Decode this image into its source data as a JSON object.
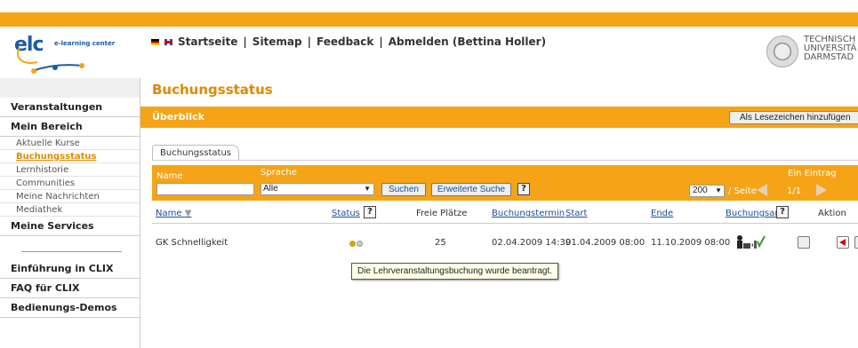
{
  "header": {
    "logo_text": "elc",
    "logo_subtitle": "e-learning center",
    "nav": [
      {
        "label": "Startseite"
      },
      {
        "label": "Sitemap"
      },
      {
        "label": "Feedback"
      },
      {
        "label": "Abmelden (Bettina Holler)"
      }
    ],
    "separator": "|",
    "university_lines": [
      "TECHNISCH",
      "UNIVERSITÄ",
      "DARMSTAD"
    ]
  },
  "sidebar": {
    "sections": [
      {
        "label": "Veranstaltungen"
      },
      {
        "label": "Mein Bereich"
      }
    ],
    "items": [
      {
        "label": "Aktuelle Kurse"
      },
      {
        "label": "Buchungsstatus"
      },
      {
        "label": "Lernhistorie"
      },
      {
        "label": "Communities"
      },
      {
        "label": "Meine Nachrichten"
      },
      {
        "label": "Mediathek"
      }
    ],
    "services": "Meine Services",
    "bottom": [
      {
        "label": "Einführung in CLIX"
      },
      {
        "label": "FAQ für CLIX"
      },
      {
        "label": "Bedienungs-Demos"
      }
    ]
  },
  "main": {
    "page_title": "Buchungsstatus",
    "overview_label": "Überblick",
    "bookmark_button": "Als Lesezeichen hinzufügen",
    "tab_label": "Buchungsstatus",
    "search": {
      "name_label": "Name",
      "name_value": "",
      "language_label": "Sprache",
      "language_value": "Alle",
      "search_button": "Suchen",
      "advanced_button": "Erweiterte Suche",
      "help": "?",
      "entries_label": "Ein Eintrag",
      "per_page_value": "200",
      "per_page_label": "/ Seite",
      "page_indicator": "1/1"
    },
    "table": {
      "columns": {
        "name": "Name",
        "status": "Status",
        "free": "Freie Plätze",
        "booking_date": "Buchungstermin",
        "start": "Start",
        "end": "Ende",
        "booking_type": "Buchungsart",
        "action": "Aktion"
      },
      "rows": [
        {
          "name": "GK Schnelligkeit",
          "free": "25",
          "booking_date": "02.04.2009 14:39",
          "start": "01.04.2009 08:00",
          "end": "11.10.2009 08:00"
        }
      ]
    },
    "tooltip": "Die Lehrveranstaltungsbuchung wurde beantragt."
  },
  "colors": {
    "accent": "#f5a417",
    "title": "#e08a00",
    "link": "#1b4f9a",
    "status_dot_1": "#d6a500",
    "status_dot_2": "#bbbbbb"
  }
}
